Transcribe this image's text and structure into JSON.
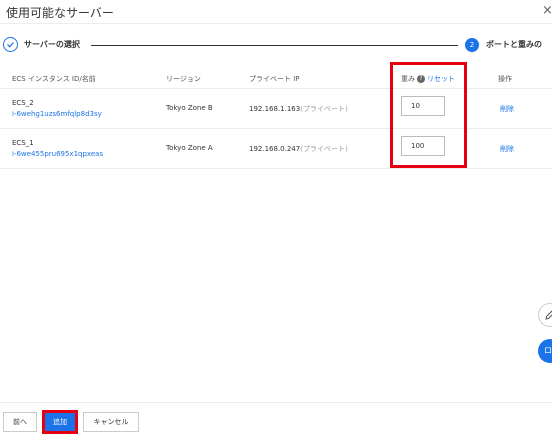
{
  "dialog": {
    "title": "使用可能なサーバー",
    "close_label": "×"
  },
  "steps": {
    "step1": {
      "label": "サーバーの選択"
    },
    "step2": {
      "number": "2",
      "label": "ポートと重みの"
    }
  },
  "table": {
    "headers": {
      "instance": "ECS インスタンス ID/名前",
      "region": "リージョン",
      "private_ip": "プライベート IP",
      "weight": "重み",
      "reset": "リセット",
      "action": "操作"
    },
    "rows": [
      {
        "name": "ECS_2",
        "id": "i-6wehg1uzs6mfqlp8d3sy",
        "region": "Tokyo Zone B",
        "ip": "192.168.1.163",
        "ip_type": "(プライベート)",
        "weight": "10",
        "action": "削除"
      },
      {
        "name": "ECS_1",
        "id": "i-6we455pru695x1qpxeas",
        "region": "Tokyo Zone A",
        "ip": "192.168.0.247",
        "ip_type": "(プライベート)",
        "weight": "100",
        "action": "削除"
      }
    ]
  },
  "side": {
    "fab2_label": "ロ"
  },
  "footer": {
    "prev": "前へ",
    "add": "追加",
    "cancel": "キャンセル"
  },
  "colors": {
    "accent": "#1a73e8",
    "highlight": "#e60012"
  }
}
